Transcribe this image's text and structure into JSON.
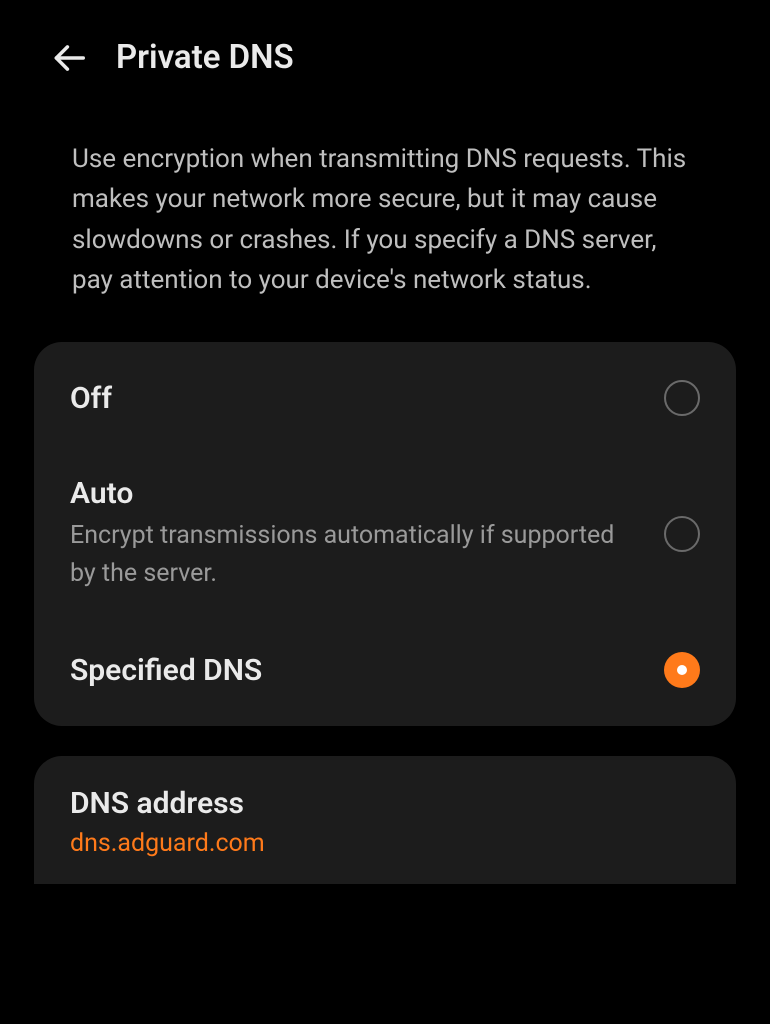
{
  "header": {
    "title": "Private DNS"
  },
  "description": "Use encryption when transmitting DNS requests. This makes your network more secure, but it may cause slowdowns or crashes. If you specify a DNS server, pay attention to your device's network status.",
  "options": {
    "off": {
      "label": "Off",
      "selected": false
    },
    "auto": {
      "label": "Auto",
      "sublabel": "Encrypt transmissions automatically if supported by the server.",
      "selected": false
    },
    "specified": {
      "label": "Specified DNS",
      "selected": true
    }
  },
  "dns_address": {
    "label": "DNS address",
    "value": "dns.adguard.com"
  },
  "colors": {
    "accent": "#ff7a1a",
    "panel_bg": "#1c1c1c",
    "text_primary": "#eaeaea",
    "text_secondary": "#9a9a9a"
  }
}
